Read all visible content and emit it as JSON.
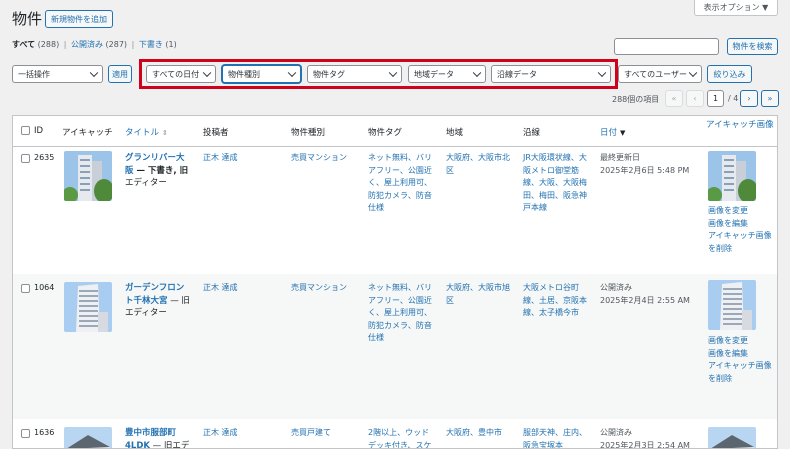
{
  "page": {
    "title": "物件",
    "add_new": "新規物件を追加",
    "screen_options": "表示オプション ▼"
  },
  "status_links": {
    "all": "すべて",
    "all_count": "(288)",
    "published": "公開済み",
    "published_count": "(287)",
    "draft": "下書き",
    "draft_count": "(1)",
    "sep": "|"
  },
  "search": {
    "button": "物件を検索",
    "placeholder": ""
  },
  "toolbar": {
    "bulk": "一括操作",
    "apply": "適用",
    "date": "すべての日付",
    "type": "物件種別",
    "tag": "物件タグ",
    "area": "地域データ",
    "line": "沿線データ",
    "user": "すべてのユーザー",
    "filter": "絞り込み"
  },
  "pagination": {
    "count": "288個の項目",
    "first": "«",
    "prev": "‹",
    "current": "1",
    "total": "/ 4",
    "next": "›",
    "last": "»"
  },
  "columns": {
    "id": "ID",
    "eyecatch": "アイキャッチ",
    "title": "タイトル",
    "author": "投稿者",
    "type": "物件種別",
    "tag": "物件タグ",
    "area": "地域",
    "line": "沿線",
    "date": "日付",
    "eyecatch_img": "アイキャッチ画像"
  },
  "rows": [
    {
      "id": "2635",
      "title_1": "グランリバー大",
      "title_2": "阪",
      "status": " — 下書き, 旧",
      "status_2": "エディター",
      "author": "正木 達成",
      "type": "売買マンション",
      "tags": [
        "ネット無料、バリ",
        "アフリー、公園近",
        "く、屋上利用可、",
        "防犯カメラ、防音",
        "仕様"
      ],
      "area": [
        "大阪府、大阪市北",
        "区"
      ],
      "line": [
        "JR大阪環状線、大",
        "阪メトロ御堂筋",
        "線、大阪、大阪梅",
        "田、梅田、阪急神",
        "戸本線"
      ],
      "date_label": "最終更新日",
      "date": "2025年2月6日 5:48 PM",
      "actions": [
        "画像を変更",
        "画像を編集",
        "アイキャッチ画像",
        "を削除"
      ]
    },
    {
      "id": "1064",
      "title_1": "ガーデンフロン",
      "title_2": "ト千林大宮",
      "status": " — 旧",
      "status_2": "エディター",
      "author": "正木 達成",
      "type": "売買マンション",
      "tags": [
        "ネット無料、バリ",
        "アフリー、公園近",
        "く、屋上利用可、",
        "防犯カメラ、防音",
        "仕様"
      ],
      "area": [
        "大阪府、大阪市旭",
        "区"
      ],
      "line": [
        "大阪メトロ谷町",
        "線、土居、京阪本",
        "線、太子橋今市"
      ],
      "date_label": "公開済み",
      "date": "2025年2月4日 2:55 AM",
      "actions": [
        "画像を変更",
        "画像を編集",
        "アイキャッチ画像",
        "を削除"
      ]
    },
    {
      "id": "1636",
      "title_1": "豊中市服部町",
      "title_2": "4LDK",
      "status": " — 旧エデ",
      "status_2": "",
      "author": "正木 達成",
      "type": "売買戸建て",
      "tags": [
        "2階以上、ウッド",
        "デッキ付き、スケ"
      ],
      "area": [
        "大阪府、豊中市"
      ],
      "line": [
        "服部天神、庄内、",
        "阪急宝塚本"
      ],
      "date_label": "公開済み",
      "date": "2025年2月3日 2:54 AM",
      "actions": []
    }
  ]
}
